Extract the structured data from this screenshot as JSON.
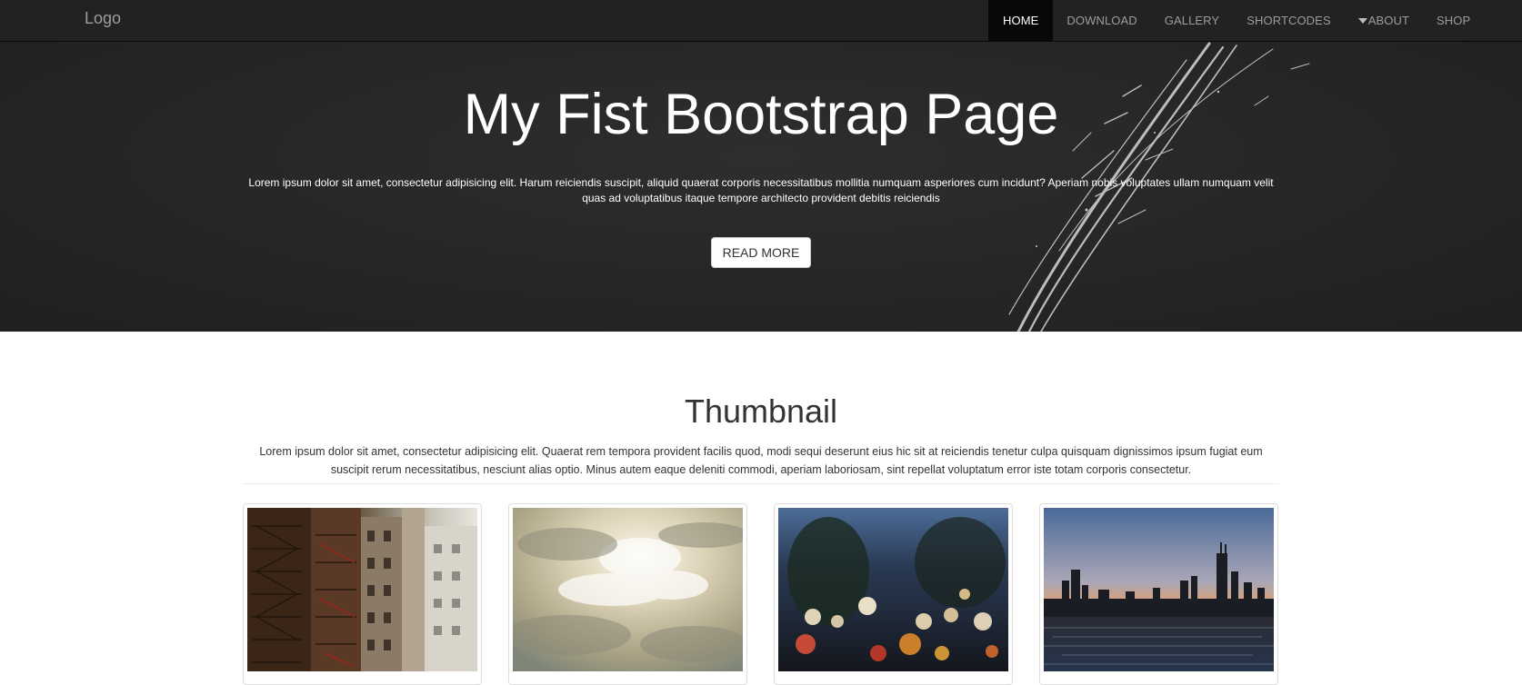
{
  "navbar": {
    "brand": "Logo",
    "items": [
      {
        "label": "HOME",
        "active": true
      },
      {
        "label": "DOWNLOAD",
        "active": false
      },
      {
        "label": "GALLERY",
        "active": false
      },
      {
        "label": "SHORTCODES",
        "active": false
      },
      {
        "label": "ABOUT",
        "active": false,
        "icon": "caret-down-icon"
      },
      {
        "label": "SHOP",
        "active": false
      }
    ]
  },
  "hero": {
    "title": "My Fist Bootstrap Page",
    "text": "Lorem ipsum dolor sit amet, consectetur adipisicing elit. Harum reiciendis suscipit, aliquid quaerat corporis necessitatibus mollitia numquam asperiores cum incidunt? Aperiam nobis voluptates ullam numquam velit quas ad voluptatibus itaque tempore architecto provident debitis reiciendis",
    "button_label": "READ MORE"
  },
  "thumbnails_section": {
    "title": "Thumbnail",
    "text": "Lorem ipsum dolor sit amet, consectetur adipisicing elit. Quaerat rem tempora provident facilis quod, modi sequi deserunt eius hic sit at reiciendis tenetur culpa quisquam dignissimos ipsum fugiat eum suscipit rerum necessitatibus, nesciunt alias optio. Minus autem eaque deleniti commodi, aperiam laboriosam, sint repellat voluptatum error iste totam corporis consectetur.",
    "images": [
      "building-fire-escapes-photo",
      "sunlit-clouds-photo",
      "city-bokeh-lights-photo",
      "city-skyline-sunset-photo"
    ]
  },
  "colors": {
    "navbar_bg": "#222222",
    "nav_active_bg": "#080808",
    "nav_text": "#9d9d9d",
    "hero_bg": "#262527",
    "body_text": "#333333"
  }
}
